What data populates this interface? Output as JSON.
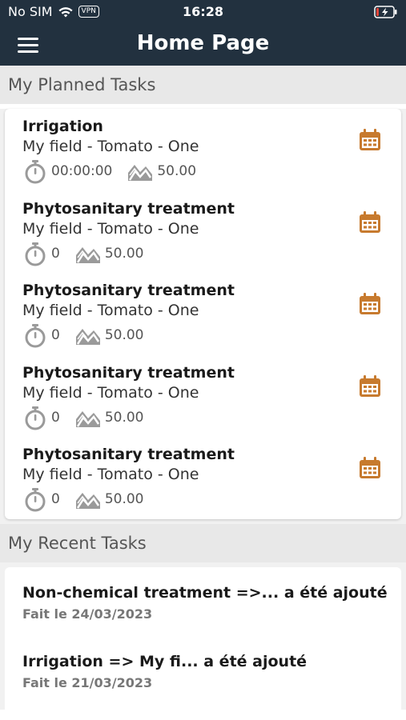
{
  "status_bar": {
    "carrier": "No SIM",
    "vpn": "VPN",
    "time": "16:28"
  },
  "header": {
    "title": "Home Page",
    "menu_icon": "hamburger-menu-icon"
  },
  "planned": {
    "section_title": "My Planned Tasks",
    "tasks": [
      {
        "title": "Irrigation",
        "subtitle": "My field - Tomato - One",
        "duration": "00:00:00",
        "area": "50.00"
      },
      {
        "title": "Phytosanitary treatment",
        "subtitle": "My field - Tomato - One",
        "duration": "0",
        "area": "50.00"
      },
      {
        "title": "Phytosanitary treatment",
        "subtitle": "My field - Tomato - One",
        "duration": "0",
        "area": "50.00"
      },
      {
        "title": "Phytosanitary treatment",
        "subtitle": "My field - Tomato - One",
        "duration": "0",
        "area": "50.00"
      },
      {
        "title": "Phytosanitary treatment",
        "subtitle": "My field - Tomato - One",
        "duration": "0",
        "area": "50.00"
      }
    ]
  },
  "recent": {
    "section_title": "My Recent Tasks",
    "items": [
      {
        "title": "Non-chemical treatment =>... a été ajouté",
        "date": "Fait le 24/03/2023"
      },
      {
        "title": "Irrigation => My fi... a été ajouté",
        "date": "Fait le 21/03/2023"
      }
    ]
  },
  "colors": {
    "header_bg": "#22313f",
    "accent_orange": "#c77a2e",
    "icon_gray": "#9a9a9a"
  }
}
